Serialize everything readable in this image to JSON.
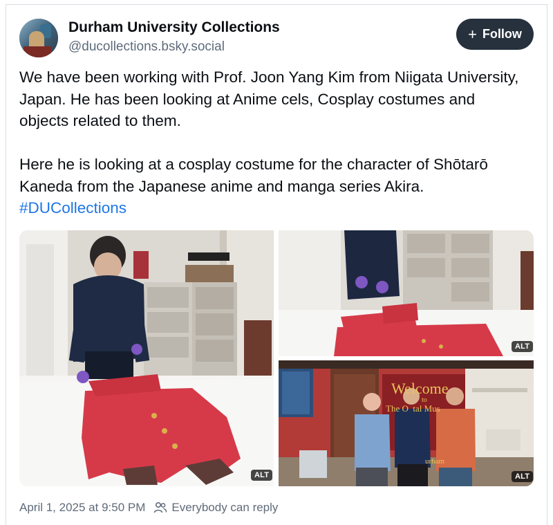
{
  "post": {
    "author_name": "Durham University Collections",
    "author_handle": "@ducollections.bsky.social",
    "follow_label": "Follow",
    "paragraph1": "We have been working with Prof. Joon Yang Kim from Niigata University, Japan. He has been looking at Anime cels, Cosplay costumes and objects related to them.",
    "paragraph2_text": "Here he is looking at a cosplay costume for the character of Shōtarō Kaneda from the Japanese anime and manga series Akira. ",
    "hashtag": "#DUCollections",
    "timestamp": "April 1, 2025 at 9:50 PM",
    "reply_setting": "Everybody can reply"
  },
  "images": [
    {
      "alt_badge": "ALT"
    },
    {
      "alt_badge": "ALT"
    },
    {
      "alt_badge": "ALT"
    }
  ],
  "scene": {
    "welcome_sign": "Welcome",
    "welcome_to": "to",
    "welcome_sub": "The O  tal Mus",
    "durham_sign": "urham"
  },
  "colors": {
    "accent": "#1d76e8",
    "follow_bg": "#26313d",
    "muted": "#5f6b7a",
    "costume_red": "#d63a49"
  }
}
